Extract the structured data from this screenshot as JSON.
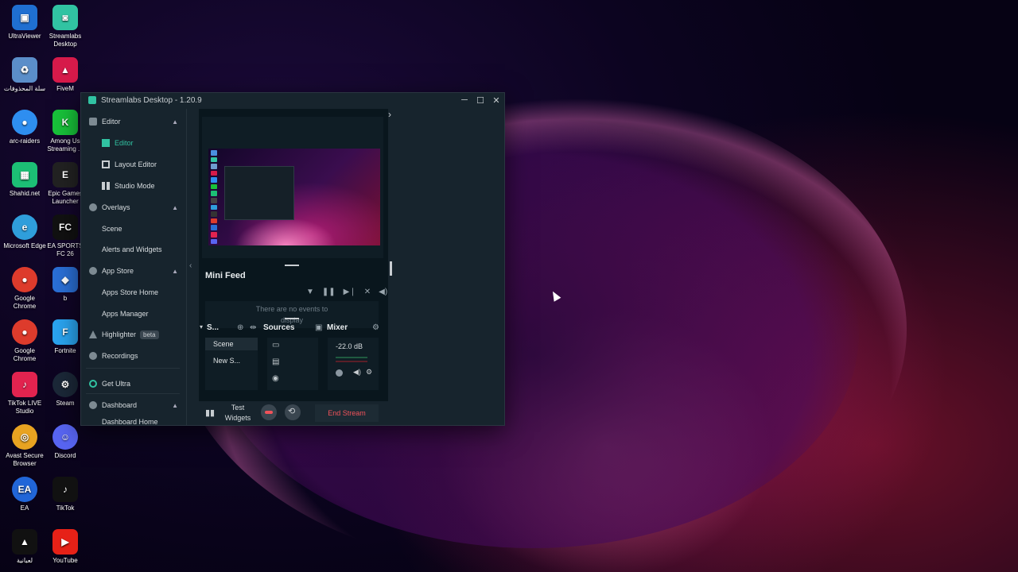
{
  "desktop": {
    "icons": [
      {
        "label": "UltraViewer",
        "icon": "ultraviewer-icon",
        "color": "#1f6fd1"
      },
      {
        "label": "Streamlabs Desktop",
        "icon": "streamlabs-icon",
        "color": "#31c3a2"
      },
      {
        "label": "سلة المحذوفات",
        "icon": "recycle-bin-icon",
        "color": "#5b8ec9"
      },
      {
        "label": "FiveM",
        "icon": "fivem-icon",
        "color": "#d61a4a"
      },
      {
        "label": "arc-raiders",
        "icon": "chrome-icon",
        "color": "#2e8ef0"
      },
      {
        "label": "Among Us Streaming ...",
        "icon": "among-us-icon",
        "color": "#18c23a"
      },
      {
        "label": "Shahid.net",
        "icon": "shahid-icon",
        "color": "#1cbf75"
      },
      {
        "label": "Epic Games Launcher",
        "icon": "epic-games-icon",
        "color": "#222222"
      },
      {
        "label": "Microsoft Edge",
        "icon": "edge-icon",
        "color": "#2f9edb"
      },
      {
        "label": "EA SPORTS FC 26",
        "icon": "ea-fc-icon",
        "color": "#111111"
      },
      {
        "label": "Google Chrome",
        "icon": "chrome-icon",
        "color": "#dd3b2c"
      },
      {
        "label": "b",
        "icon": "rocket-league-icon",
        "color": "#2a6fd6"
      },
      {
        "label": "Google Chrome",
        "icon": "chrome-icon",
        "color": "#dd3b2c"
      },
      {
        "label": "Fortnite",
        "icon": "fortnite-icon",
        "color": "#2aa4f0"
      },
      {
        "label": "TikTok LIVE Studio",
        "icon": "tiktok-live-icon",
        "color": "#e2234f"
      },
      {
        "label": "Steam",
        "icon": "steam-icon",
        "color": "#1b2838"
      },
      {
        "label": "Avast Secure Browser",
        "icon": "avast-icon",
        "color": "#e8a321"
      },
      {
        "label": "Discord",
        "icon": "discord-icon",
        "color": "#5865f2"
      },
      {
        "label": "EA",
        "icon": "ea-icon",
        "color": "#2166d8"
      },
      {
        "label": "TikTok",
        "icon": "tiktok-icon",
        "color": "#111111"
      },
      {
        "label": "لعبانية",
        "icon": "app-icon",
        "color": "#111111"
      },
      {
        "label": "YouTube",
        "icon": "youtube-icon",
        "color": "#e62117"
      }
    ]
  },
  "window": {
    "title": "Streamlabs Desktop - 1.20.9",
    "controls": {
      "minimize": "─",
      "maximize": "☐",
      "close": "✕"
    }
  },
  "sidebar": {
    "editor_section": "Editor",
    "editor": "Editor",
    "layout_editor": "Layout Editor",
    "studio_mode": "Studio Mode",
    "overlays_section": "Overlays",
    "scene": "Scene",
    "alerts_widgets": "Alerts and Widgets",
    "app_store_section": "App Store",
    "apps_store_home": "Apps Store Home",
    "apps_manager": "Apps Manager",
    "highlighter": "Highlighter",
    "highlighter_badge": "beta",
    "recordings": "Recordings",
    "get_ultra": "Get Ultra",
    "dashboard_section": "Dashboard",
    "dashboard_home": "Dashboard Home"
  },
  "main": {
    "mini_feed_title": "Mini Feed",
    "mini_feed_empty": "There are no events to display",
    "scenes_title": "S...",
    "sources_title": "Sources",
    "mixer_title": "Mixer",
    "scenes": [
      "Scene",
      "New S..."
    ],
    "mixer_db": "-22.0 dB",
    "test_widgets": "Test Widgets",
    "end_stream": "End Stream"
  },
  "colors": {
    "accent": "#31c3a2",
    "end_stream": "#f0525a"
  }
}
